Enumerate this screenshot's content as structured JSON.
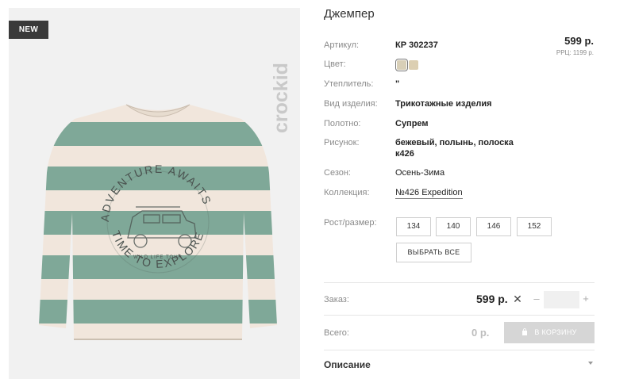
{
  "product": {
    "badge": "NEW",
    "brand": "crockid",
    "artwork_text": [
      "ADVENTURE AWAITS",
      "TIME TO EXPLORE",
      "WILD LIFE TOUR"
    ],
    "title": "Джемпер",
    "price": "599 р.",
    "rrp": "РРЦ: 1199 р."
  },
  "specs": {
    "article": {
      "label": "Артикул:",
      "value": "КР 302237"
    },
    "color": {
      "label": "Цвет:",
      "swatches": [
        "#d8cfb7",
        "#dccfb2"
      ]
    },
    "insulation": {
      "label": "Утеплитель:",
      "value": "\""
    },
    "type": {
      "label": "Вид изделия:",
      "value": "Трикотажные изделия"
    },
    "fabric": {
      "label": "Полотно:",
      "value": "Супрем"
    },
    "pattern": {
      "label": "Рисунок:",
      "value_line1": "бежевый, полынь, полоска",
      "value_line2": "к426"
    },
    "season": {
      "label": "Сезон:",
      "value": "Осень-Зима"
    },
    "collection": {
      "label": "Коллекция:",
      "value": "№426 Expedition"
    }
  },
  "sizes": {
    "label": "Рост/размер:",
    "options": [
      "134",
      "140",
      "146",
      "152"
    ],
    "select_all": "ВЫБРАТЬ ВСЕ"
  },
  "order": {
    "label": "Заказ:",
    "price": "599 р.",
    "remove_icon": "close-icon",
    "minus": "–",
    "plus": "+",
    "quantity": ""
  },
  "total": {
    "label": "Всего:",
    "value": "0 р.",
    "cart_button": "В КОРЗИНУ",
    "cart_icon": "shopping-bag-icon"
  },
  "description": {
    "label": "Описание",
    "icon": "chevron-down-icon"
  },
  "colors": {
    "stripe_green": "#7fa898",
    "stripe_cream": "#f1e6dc",
    "badge_bg": "#3a3a3a",
    "button_disabled": "#d6d6d6"
  }
}
